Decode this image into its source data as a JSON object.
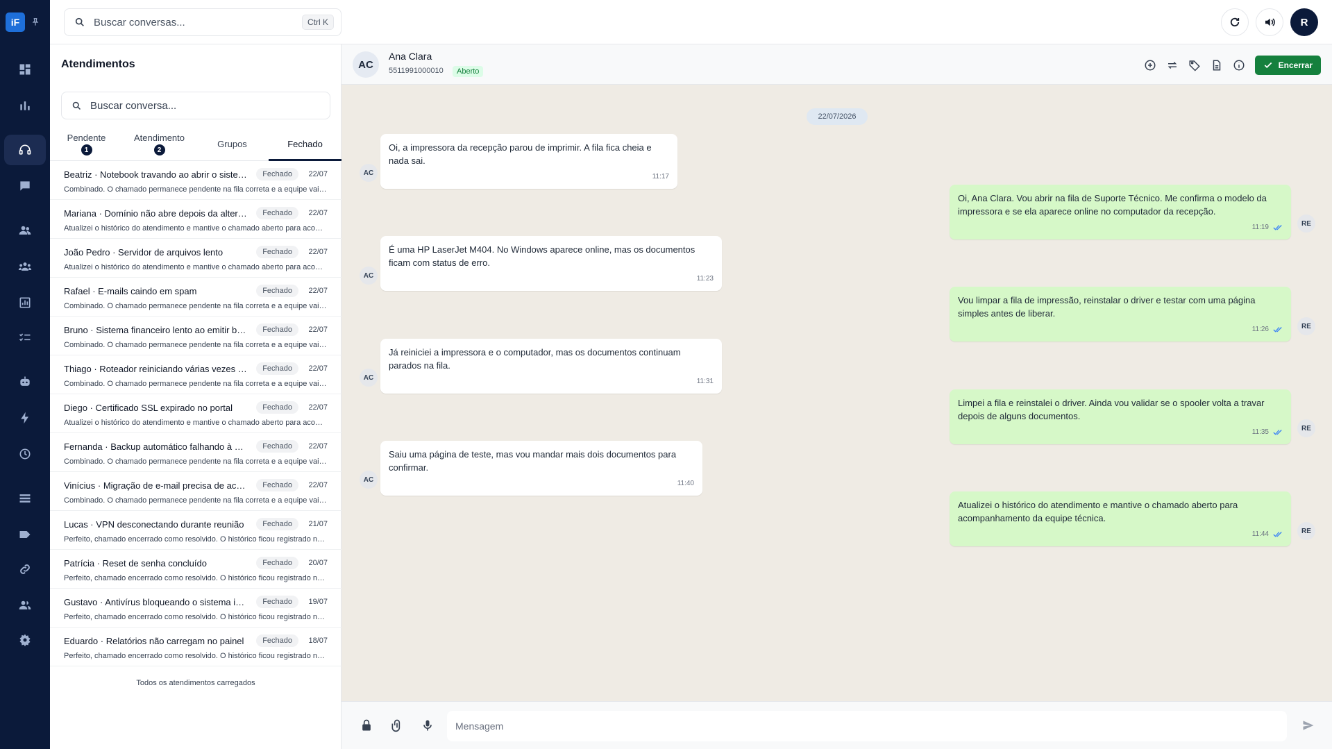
{
  "app": {
    "logo_text": "iF",
    "brand_color": "#1e6fd9",
    "rail_color": "#0b1a3a"
  },
  "rail": {
    "items": [
      {
        "icon": "dashboard-icon"
      },
      {
        "icon": "bar-chart-icon"
      },
      {
        "icon": "headset-icon",
        "active": true
      },
      {
        "icon": "chat-icon"
      },
      {
        "icon": "contacts-icon"
      },
      {
        "icon": "team-icon"
      },
      {
        "icon": "reports-icon"
      },
      {
        "icon": "checklist-icon"
      },
      {
        "icon": "bot-icon"
      },
      {
        "icon": "bolt-icon"
      },
      {
        "icon": "clock-icon"
      },
      {
        "icon": "list-icon"
      },
      {
        "icon": "tag-icon"
      },
      {
        "icon": "link-icon"
      },
      {
        "icon": "users-icon"
      },
      {
        "icon": "settings-icon"
      }
    ]
  },
  "topbar": {
    "search_placeholder": "Buscar conversas...",
    "search_shortcut": "Ctrl K",
    "user_initial": "R"
  },
  "list": {
    "title": "Atendimentos",
    "search_placeholder": "Buscar conversa...",
    "tabs": [
      {
        "label": "Pendente",
        "badge": "1"
      },
      {
        "label": "Atendimento",
        "badge": "2"
      },
      {
        "label": "Grupos",
        "badge": ""
      },
      {
        "label": "Fechado",
        "badge": "",
        "active": true
      }
    ],
    "conversations": [
      {
        "title": "Beatriz · Notebook travando ao abrir o sistema",
        "status": "Fechado",
        "date": "22/07",
        "preview": "Combinado. O chamado permanece pendente na fila correta e a equipe vai retornar."
      },
      {
        "title": "Mariana · Domínio não abre depois da alteração de DNS",
        "status": "Fechado",
        "date": "22/07",
        "preview": "Atualizei o histórico do atendimento e mantive o chamado aberto para acompanhamento."
      },
      {
        "title": "João Pedro · Servidor de arquivos lento",
        "status": "Fechado",
        "date": "22/07",
        "preview": "Atualizei o histórico do atendimento e mantive o chamado aberto para acompanhamento."
      },
      {
        "title": "Rafael · E-mails caindo em spam",
        "status": "Fechado",
        "date": "22/07",
        "preview": "Combinado. O chamado permanece pendente na fila correta e a equipe vai retornar."
      },
      {
        "title": "Bruno · Sistema financeiro lento ao emitir boletos",
        "status": "Fechado",
        "date": "22/07",
        "preview": "Combinado. O chamado permanece pendente na fila correta e a equipe vai retornar."
      },
      {
        "title": "Thiago · Roteador reiniciando várias vezes ao dia",
        "status": "Fechado",
        "date": "22/07",
        "preview": "Combinado. O chamado permanece pendente na fila correta e a equipe vai retornar."
      },
      {
        "title": "Diego · Certificado SSL expirado no portal",
        "status": "Fechado",
        "date": "22/07",
        "preview": "Atualizei o histórico do atendimento e mantive o chamado aberto para acompanhamento."
      },
      {
        "title": "Fernanda · Backup automático falhando à noite",
        "status": "Fechado",
        "date": "22/07",
        "preview": "Combinado. O chamado permanece pendente na fila correta e a equipe vai retornar."
      },
      {
        "title": "Vinícius · Migração de e-mail precisa de acompanhamento",
        "status": "Fechado",
        "date": "22/07",
        "preview": "Combinado. O chamado permanece pendente na fila correta e a equipe vai retornar."
      },
      {
        "title": "Lucas · VPN desconectando durante reunião",
        "status": "Fechado",
        "date": "21/07",
        "preview": "Perfeito, chamado encerrado como resolvido. O histórico ficou registrado no sistema."
      },
      {
        "title": "Patrícia · Reset de senha concluído",
        "status": "Fechado",
        "date": "20/07",
        "preview": "Perfeito, chamado encerrado como resolvido. O histórico ficou registrado no sistema."
      },
      {
        "title": "Gustavo · Antivírus bloqueando o sistema interno",
        "status": "Fechado",
        "date": "19/07",
        "preview": "Perfeito, chamado encerrado como resolvido. O histórico ficou registrado no sistema."
      },
      {
        "title": "Eduardo · Relatórios não carregam no painel",
        "status": "Fechado",
        "date": "18/07",
        "preview": "Perfeito, chamado encerrado como resolvido. O histórico ficou registrado no sistema."
      }
    ],
    "footer": "Todos os atendimentos carregados"
  },
  "chat": {
    "contact": {
      "initials": "AC",
      "name": "Ana Clara",
      "phone": "5511991000010",
      "status": "Aberto"
    },
    "close_label": "Encerrar",
    "date_divider": "22/07/2026",
    "messages": [
      {
        "direction": "in",
        "avatar": "AC",
        "text": "Oi, a impressora da recepção parou de imprimir. A fila fica cheia e nada sai.",
        "time": "11:17"
      },
      {
        "direction": "out",
        "avatar": "RE",
        "text": "Oi, Ana Clara. Vou abrir na fila de Suporte Técnico. Me confirma o modelo da impressora e se ela aparece online no computador da recepção.",
        "time": "11:19"
      },
      {
        "direction": "in",
        "avatar": "AC",
        "text": "É uma HP LaserJet M404. No Windows aparece online, mas os documentos ficam com status de erro.",
        "time": "11:23"
      },
      {
        "direction": "out",
        "avatar": "RE",
        "text": "Vou limpar a fila de impressão, reinstalar o driver e testar com uma página simples antes de liberar.",
        "time": "11:26"
      },
      {
        "direction": "in",
        "avatar": "AC",
        "text": "Já reiniciei a impressora e o computador, mas os documentos continuam parados na fila.",
        "time": "11:31"
      },
      {
        "direction": "out",
        "avatar": "RE",
        "text": "Limpei a fila e reinstalei o driver. Ainda vou validar se o spooler volta a travar depois de alguns documentos.",
        "time": "11:35"
      },
      {
        "direction": "in",
        "avatar": "AC",
        "text": "Saiu uma página de teste, mas vou mandar mais dois documentos para confirmar.",
        "time": "11:40"
      },
      {
        "direction": "out",
        "avatar": "RE",
        "text": "Atualizei o histórico do atendimento e mantive o chamado aberto para acompanhamento da equipe técnica.",
        "time": "11:44"
      }
    ],
    "composer_placeholder": "Mensagem"
  },
  "colors": {
    "outgoing_bubble": "#d6f8c8",
    "chat_background": "#efebe4",
    "close_button": "#15803d"
  }
}
